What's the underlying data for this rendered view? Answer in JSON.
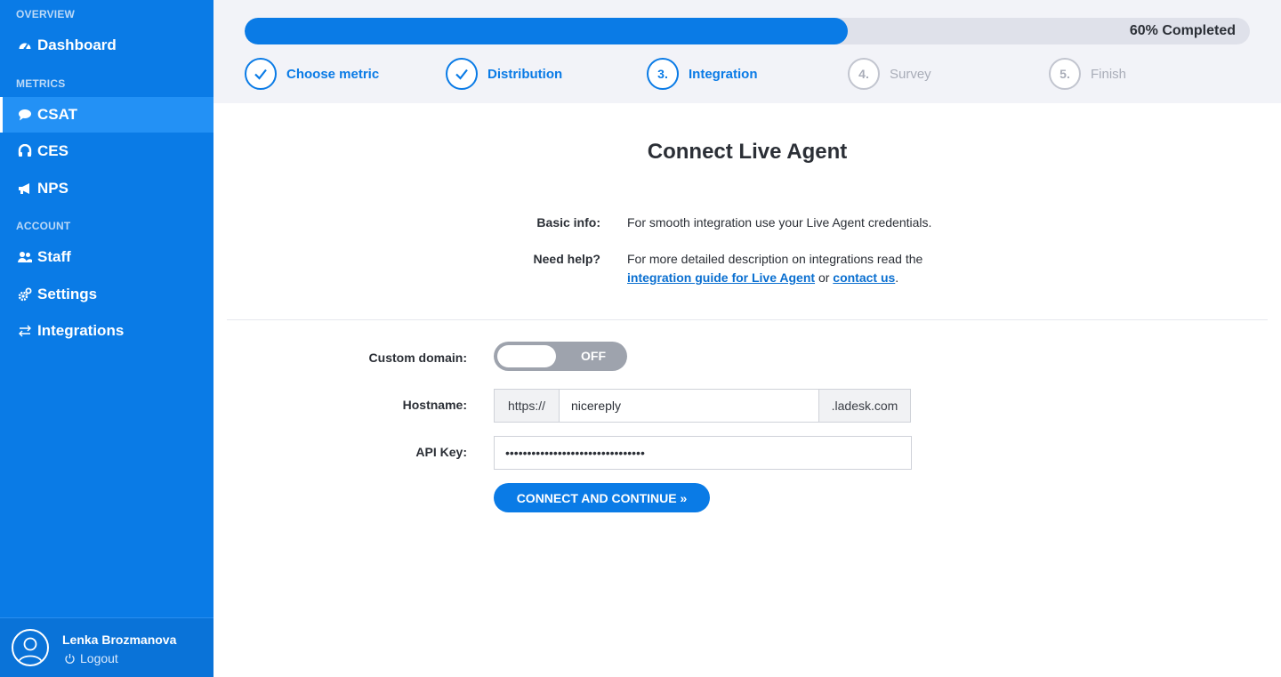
{
  "colors": {
    "accent": "#0a7be6",
    "sidebar_active": "#2391f5",
    "progress_track": "#dfe1ea",
    "toggle_off": "#9ea3ad"
  },
  "sidebar": {
    "sections": {
      "overview": "OVERVIEW",
      "metrics": "METRICS",
      "account": "ACCOUNT"
    },
    "items": [
      {
        "label": "Dashboard",
        "icon": "dashboard-gauge-icon",
        "active": false
      },
      {
        "label": "CSAT",
        "icon": "chat-bubble-icon",
        "active": true
      },
      {
        "label": "CES",
        "icon": "ces-icon",
        "active": false
      },
      {
        "label": "NPS",
        "icon": "megaphone-icon",
        "active": false
      },
      {
        "label": "Staff",
        "icon": "users-icon",
        "active": false
      },
      {
        "label": "Settings",
        "icon": "gears-icon",
        "active": false
      },
      {
        "label": "Integrations",
        "icon": "arrows-exchange-icon",
        "active": false
      }
    ],
    "user": {
      "name": "Lenka Brozmanova",
      "logout": "Logout",
      "avatar_icon": "user-avatar-icon",
      "logout_icon": "power-icon"
    }
  },
  "progress": {
    "percent": 60,
    "label": "60% Completed"
  },
  "steps": [
    {
      "marker": "",
      "label": "Choose metric",
      "state": "done"
    },
    {
      "marker": "",
      "label": "Distribution",
      "state": "done"
    },
    {
      "marker": "3.",
      "label": "Integration",
      "state": "current"
    },
    {
      "marker": "4.",
      "label": "Survey",
      "state": "pending"
    },
    {
      "marker": "5.",
      "label": "Finish",
      "state": "pending"
    }
  ],
  "main": {
    "title": "Connect Live Agent",
    "basic_info_label": "Basic info:",
    "basic_info_text": "For smooth integration use your Live Agent credentials.",
    "help_label": "Need help?",
    "help_text": "For more detailed description on integrations read the",
    "help_link_guide": "integration guide for Live Agent",
    "help_or": "or",
    "help_link_contact": "contact us",
    "help_end": "."
  },
  "form": {
    "custom_domain_label": "Custom domain:",
    "toggle_state": "OFF",
    "hostname_label": "Hostname:",
    "hostname_prefix": "https://",
    "hostname_value": "nicereply",
    "hostname_suffix": ".ladesk.com",
    "api_key_label": "API Key:",
    "api_key_value": "••••••••••••••••••••••••••••••••",
    "submit_label": "CONNECT AND CONTINUE »"
  }
}
